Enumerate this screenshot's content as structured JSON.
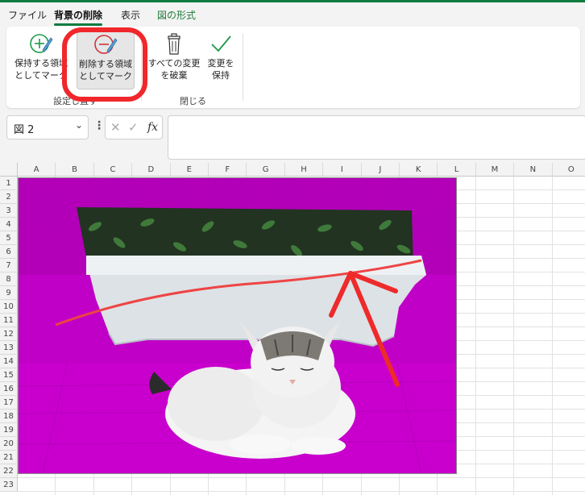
{
  "tabs": [
    {
      "label": "ファイル"
    },
    {
      "label": "背景の削除"
    },
    {
      "label": "表示"
    },
    {
      "label": "図の形式"
    }
  ],
  "ribbon": {
    "keep": {
      "line1": "保持する領域",
      "line2": "としてマーク"
    },
    "remove": {
      "line1": "削除する領域",
      "line2": "としてマーク"
    },
    "discard": {
      "line1": "すべての変更",
      "line2": "を破棄"
    },
    "keepchanges": {
      "line1": "変更を",
      "line2": "保持"
    },
    "group_refine": "設定し直す",
    "group_close": "閉じる"
  },
  "formula_bar": {
    "name_box": "図 2",
    "fx": "fx",
    "cancel": "✕",
    "confirm": "✓"
  },
  "sheet": {
    "columns": [
      "A",
      "B",
      "C",
      "D",
      "E",
      "F",
      "G",
      "H",
      "I",
      "J",
      "K",
      "L",
      "M",
      "N",
      "O"
    ],
    "rows": [
      "1",
      "2",
      "3",
      "4",
      "5",
      "6",
      "7",
      "8",
      "9",
      "10",
      "11",
      "12",
      "13",
      "14",
      "15",
      "16",
      "17",
      "18",
      "19",
      "20",
      "21",
      "22",
      "23"
    ]
  },
  "colors": {
    "accent": "#0f7b3f",
    "highlight": "#f0272b",
    "magenta": "#c000c6"
  }
}
